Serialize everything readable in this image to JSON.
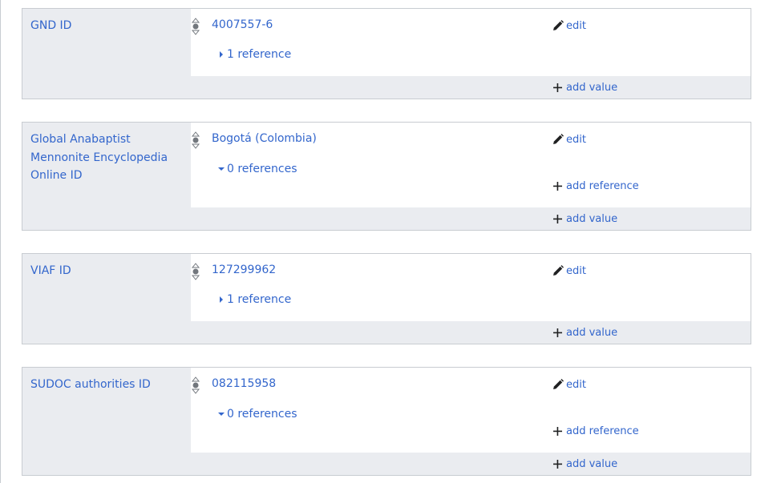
{
  "groups": [
    {
      "property": "GND ID",
      "value": "4007557-6",
      "references": "1 reference",
      "refs_expanded": false,
      "show_add_reference": false
    },
    {
      "property": "Global Anabaptist Mennonite Encyclopedia Online ID",
      "value": "Bogotá (Colombia)",
      "references": "0 references",
      "refs_expanded": true,
      "show_add_reference": true
    },
    {
      "property": "VIAF ID",
      "value": "127299962",
      "references": "1 reference",
      "refs_expanded": false,
      "show_add_reference": false
    },
    {
      "property": "SUDOC authorities ID",
      "value": "082115958",
      "references": "0 references",
      "refs_expanded": true,
      "show_add_reference": true
    }
  ],
  "labels": {
    "edit": "edit",
    "add_reference": "add reference",
    "add_value": "add value"
  },
  "colors": {
    "link": "#3366cc",
    "group_bg": "#eaecf0",
    "border": "#c8ccd1"
  },
  "icons": {
    "rank": "normal-rank-icon",
    "edit": "pencil-icon",
    "add": "plus-icon",
    "collapsed": "triangle-right-icon",
    "expanded": "triangle-down-icon"
  }
}
